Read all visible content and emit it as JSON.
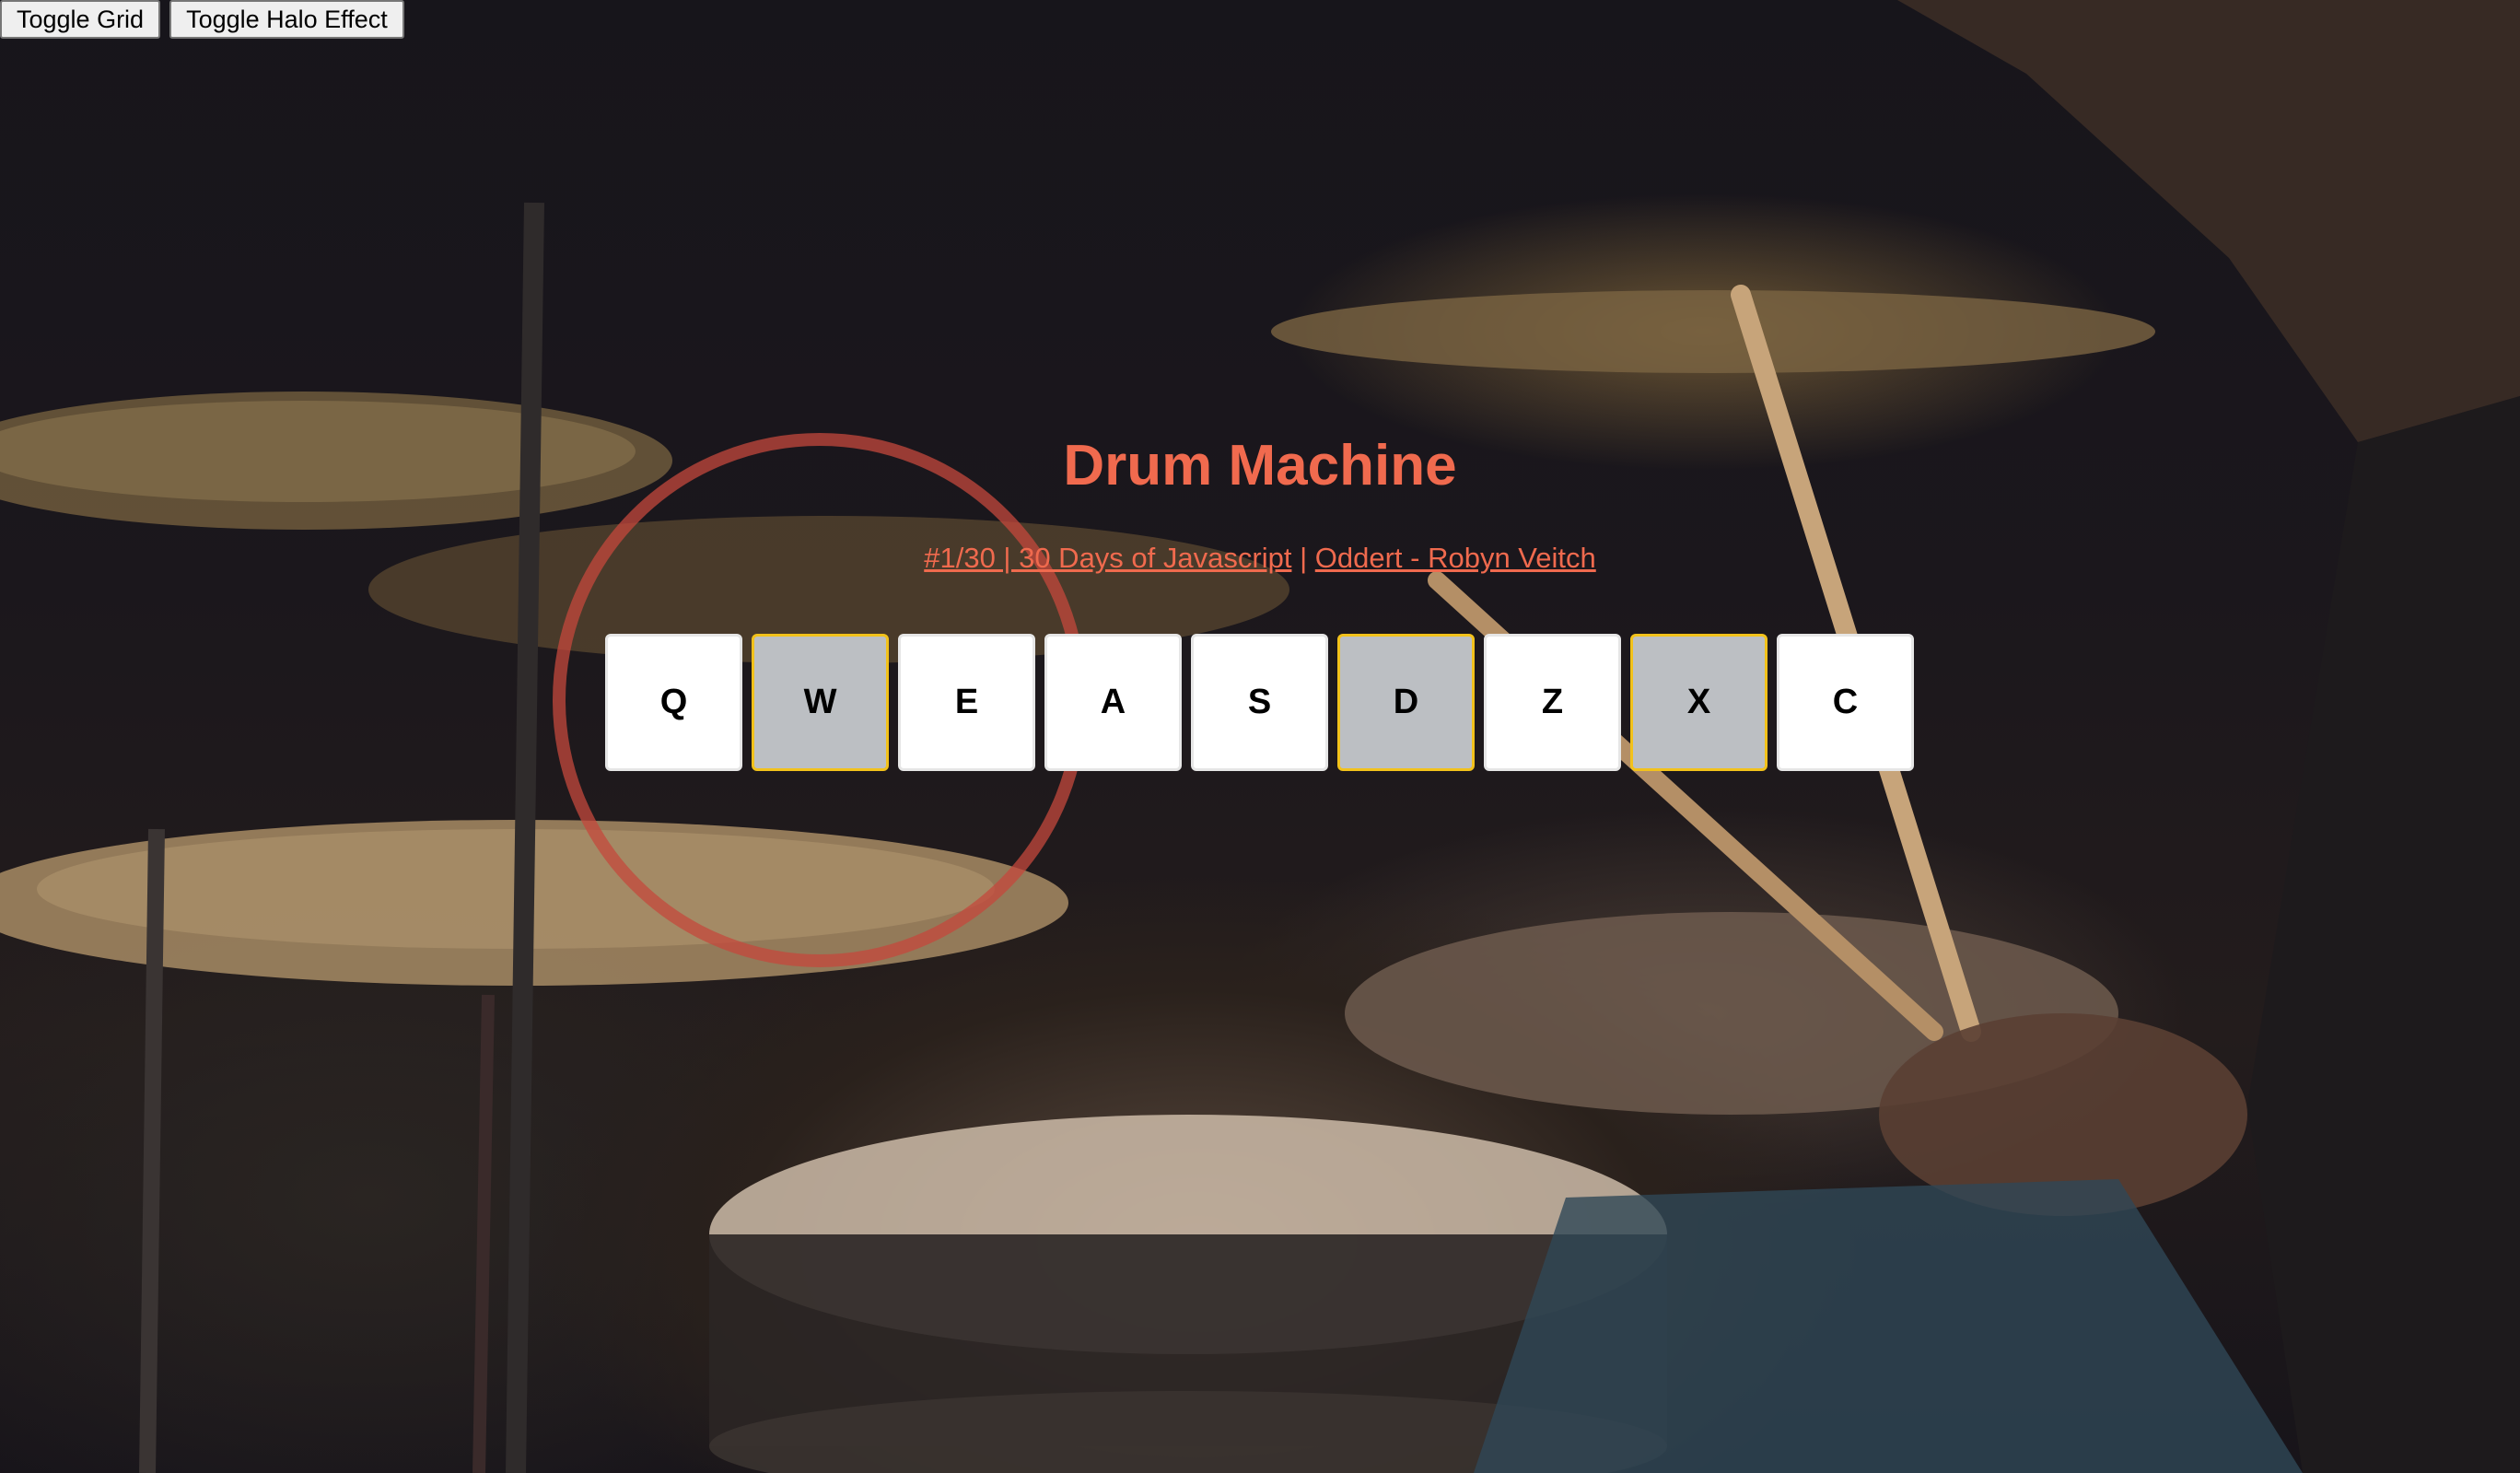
{
  "toolbar": {
    "toggle_grid_label": "Toggle Grid",
    "toggle_halo_label": "Toggle Halo Effect"
  },
  "header": {
    "title": "Drum Machine",
    "link_project": "#1/30 | 30 Days of Javascript",
    "separator": "|",
    "link_author": "Oddert - Robyn Veitch"
  },
  "keys": [
    {
      "label": "Q",
      "active": false
    },
    {
      "label": "W",
      "active": true
    },
    {
      "label": "E",
      "active": false
    },
    {
      "label": "A",
      "active": false
    },
    {
      "label": "S",
      "active": false
    },
    {
      "label": "D",
      "active": true
    },
    {
      "label": "Z",
      "active": false
    },
    {
      "label": "X",
      "active": true
    },
    {
      "label": "C",
      "active": false
    }
  ],
  "colors": {
    "accent": "#f06a4e",
    "key_active_border": "#f2c21b",
    "key_active_bg": "#bcbfc3",
    "halo": "#c4483c"
  }
}
